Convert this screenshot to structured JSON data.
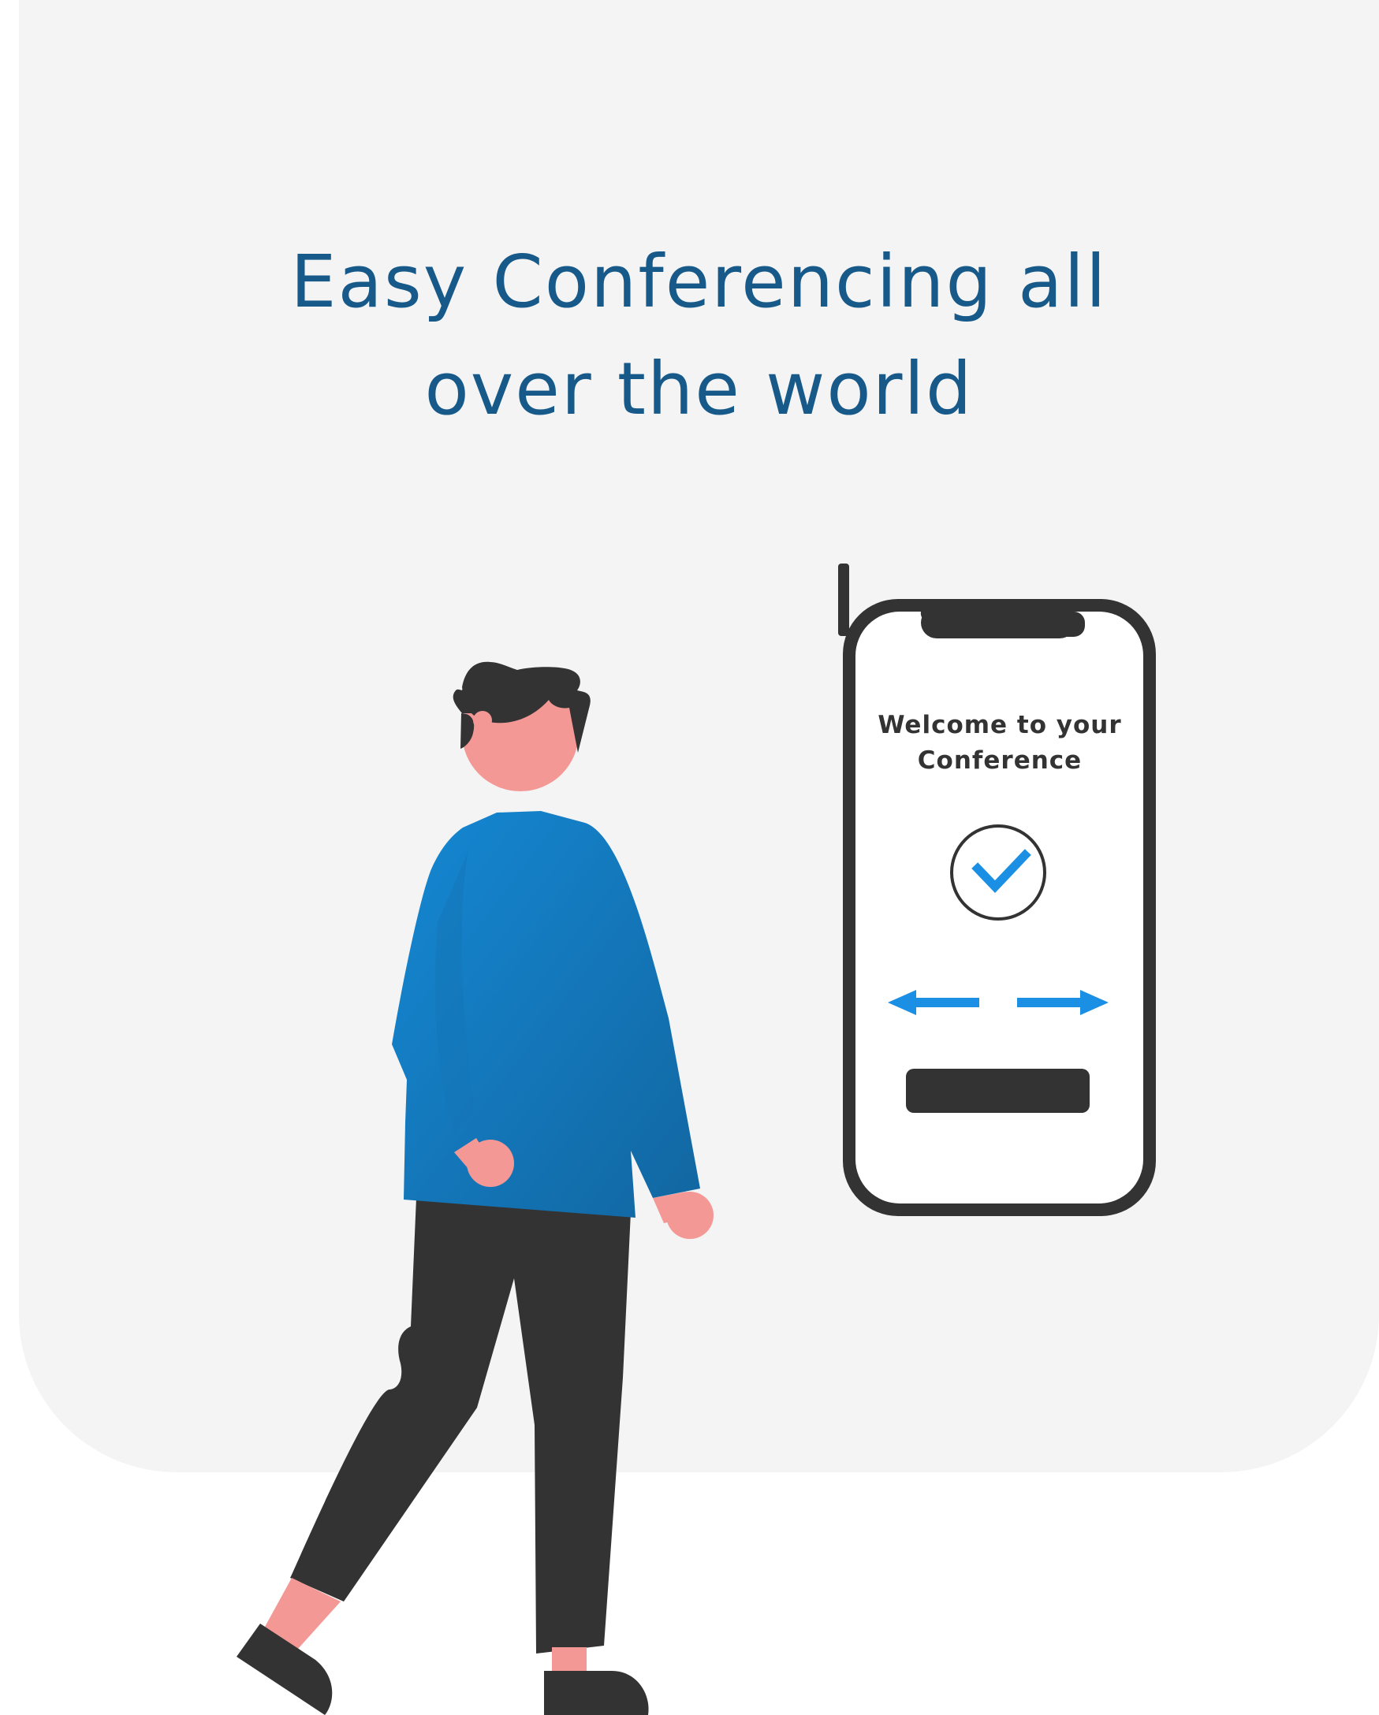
{
  "hero": {
    "title_line1": "Easy Conferencing all",
    "title_line2": "over the world"
  },
  "phone": {
    "welcome_line1": "Welcome to your",
    "welcome_line2": "Conference",
    "check_icon": "check-circle-icon",
    "left_arrow_icon": "arrow-left-icon",
    "right_arrow_icon": "arrow-right-icon"
  },
  "colors": {
    "background_panel": "#f4f4f4",
    "title": "#175a8a",
    "phone_frame": "#333333",
    "accent_blue": "#1a8fe3",
    "shirt_blue": "#1582c6",
    "skin": "#f49896",
    "dark": "#333333"
  }
}
